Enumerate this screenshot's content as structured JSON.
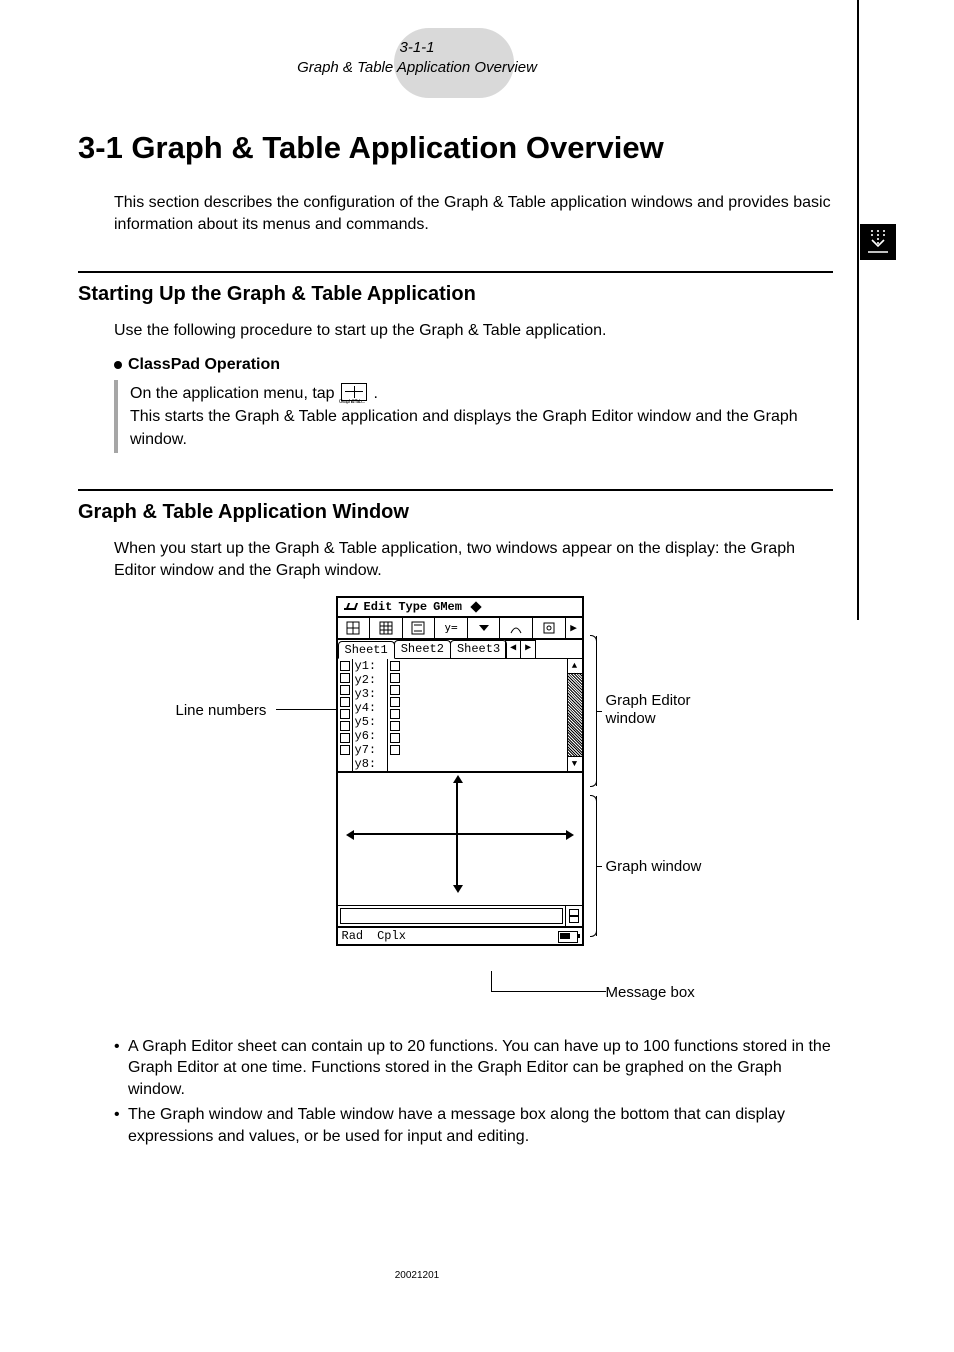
{
  "header": {
    "section_number": "3-1-1",
    "section_label": "Graph & Table Application Overview"
  },
  "title": "3-1 Graph & Table Application Overview",
  "intro": "This section describes the configuration of the Graph & Table application windows and provides basic information about its menus and commands.",
  "section1": {
    "heading": "Starting Up the Graph & Table Application",
    "text": "Use the following procedure to start up the Graph & Table application.",
    "op_heading": "ClassPad Operation",
    "op_line1_a": "On the application menu, tap ",
    "op_line1_b": ".",
    "op_icon_label": "Graph&Tab...",
    "op_line2": "This starts the Graph & Table application and displays the Graph Editor window and the Graph window."
  },
  "section2": {
    "heading": "Graph & Table Application Window",
    "text": "When you start up the Graph & Table application, two windows appear on the display: the Graph Editor window and the Graph window."
  },
  "diagram": {
    "menu": [
      "Edit",
      "Type",
      "GMem"
    ],
    "tabs": [
      "Sheet1",
      "Sheet2",
      "Sheet3"
    ],
    "lines": [
      "y1:",
      "y2:",
      "y3:",
      "y4:",
      "y5:",
      "y6:",
      "y7:",
      "y8:"
    ],
    "status": [
      "Rad",
      "Cplx"
    ],
    "tool_y": "y=",
    "callouts": {
      "line_numbers": "Line numbers",
      "graph_editor": "Graph Editor window",
      "graph_window": "Graph window",
      "message_box": "Message box"
    }
  },
  "bullets": [
    "A Graph Editor sheet can contain up to 20 functions. You can have up to 100 functions stored in the Graph Editor at one time. Functions stored in the Graph Editor can be graphed on the Graph window.",
    "The Graph window and Table window have a message box along the bottom that can display expressions and values, or be used for input and editing."
  ],
  "footer_id": "20021201"
}
